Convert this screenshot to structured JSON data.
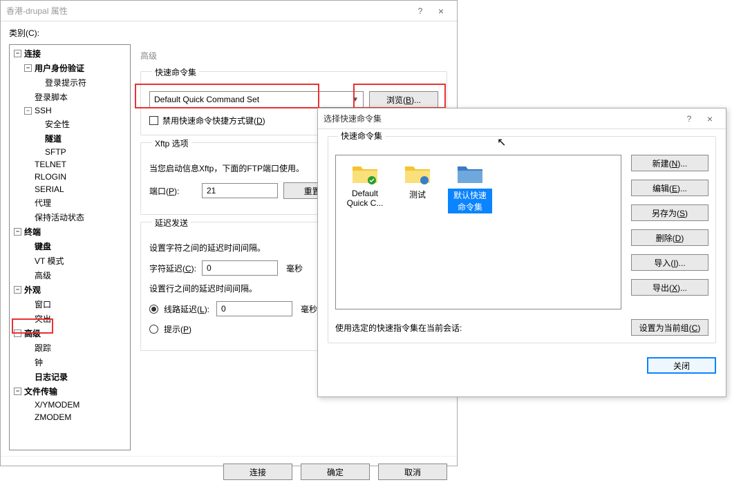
{
  "main": {
    "title": "香港-drupal 属性",
    "help": "?",
    "close": "×",
    "category_label": "类别(C):",
    "tree": {
      "conn": "连接",
      "auth": "用户身份验证",
      "login_prompt": "登录提示符",
      "login_script": "登录脚本",
      "ssh": "SSH",
      "security": "安全性",
      "tunnel": "隧道",
      "sftp": "SFTP",
      "telnet": "TELNET",
      "rlogin": "RLOGIN",
      "serial": "SERIAL",
      "proxy": "代理",
      "keepalive": "保持活动状态",
      "terminal": "终端",
      "keyboard": "键盘",
      "vtmode": "VT 模式",
      "advanced_term": "高级",
      "appearance": "外观",
      "win": "窗口",
      "highlight": "突出",
      "advanced": "高级",
      "trace": "跟踪",
      "bell": "钟",
      "logging": "日志记录",
      "file_transfer": "文件传输",
      "xymodem": "X/YMODEM",
      "zmodem": "ZMODEM"
    },
    "section_title": "高级",
    "quickcmd": {
      "legend": "快速命令集",
      "dropdown_value": "Default Quick Command Set",
      "browse_btn": "浏览(B)...",
      "disable_hotkey": "禁用快速命令快捷方式键(D)"
    },
    "xftp": {
      "legend": "Xftp 选项",
      "desc": "当您启动信息Xftp，下面的FTP端口使用。",
      "port_label": "端口(P):",
      "port_value": "21",
      "reset_btn": "重置(R)"
    },
    "delay": {
      "legend": "延迟发送",
      "desc1": "设置字符之间的延迟时间间隔。",
      "char_label": "字符延迟(C):",
      "char_value": "0",
      "unit": "毫秒",
      "desc2": "设置行之间的延迟时间间隔。",
      "line_radio": "线路延迟(L):",
      "line_value": "0",
      "prompt_radio": "提示(P)"
    },
    "footer": {
      "connect": "连接",
      "ok": "确定",
      "cancel": "取消"
    }
  },
  "dialog": {
    "title": "选择快速命令集",
    "help": "?",
    "close": "×",
    "legend": "快速命令集",
    "items": {
      "default": "Default Quick C...",
      "test": "测试",
      "default_set": "默认快速命令集"
    },
    "btns": {
      "new": "新建(N)...",
      "edit": "编辑(E)...",
      "saveas": "另存为(S)",
      "delete": "删除(D)",
      "import": "导入(I)...",
      "export": "导出(X)..."
    },
    "prompt": "使用选定的快速指令集在当前会话:",
    "set_current": "设置为当前组(C)",
    "close_btn": "关闭"
  }
}
